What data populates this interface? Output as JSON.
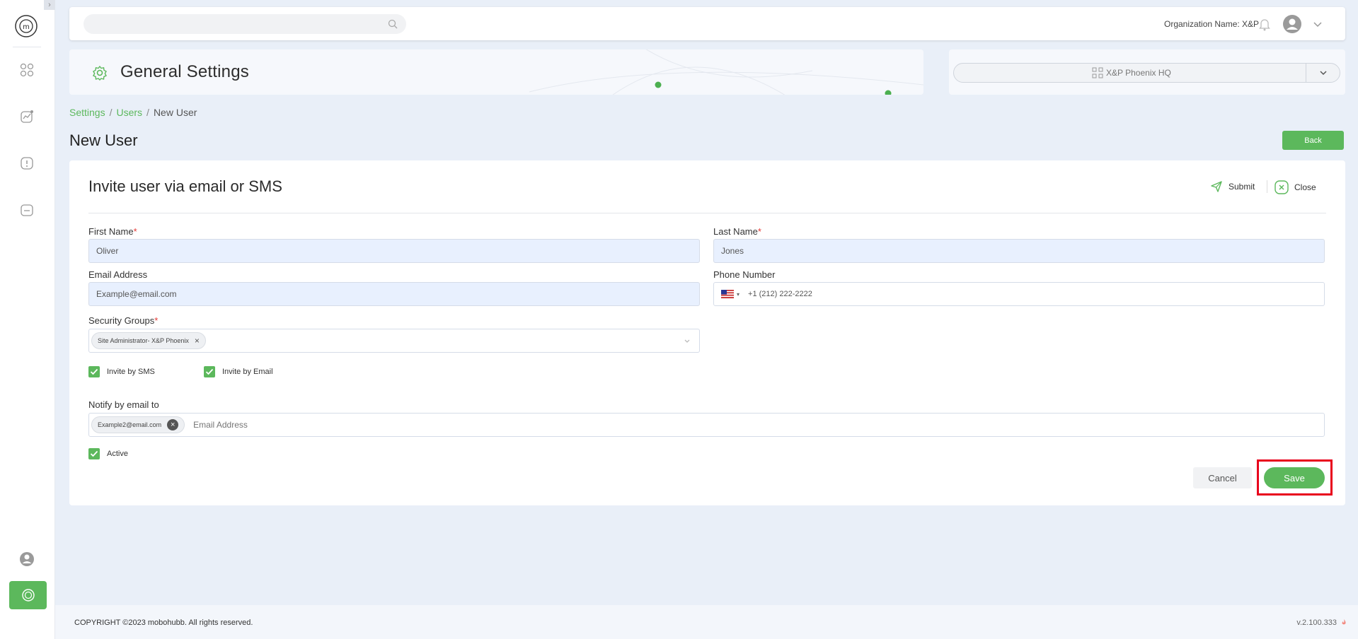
{
  "topbar": {
    "search_placeholder": "",
    "org_label": "Organization Name: X&P"
  },
  "banner": {
    "title": "General Settings"
  },
  "site_selector": {
    "selected": "X&P Phoenix HQ"
  },
  "breadcrumb": {
    "items": [
      "Settings",
      "Users",
      "New User"
    ],
    "separator": "/"
  },
  "page": {
    "title": "New User",
    "back_label": "Back"
  },
  "card": {
    "title": "Invite user via email or SMS",
    "submit_label": "Submit",
    "close_label": "Close"
  },
  "form": {
    "first_name": {
      "label": "First Name",
      "required": "*",
      "value": "Oliver"
    },
    "last_name": {
      "label": "Last Name",
      "required": "*",
      "value": "Jones"
    },
    "email": {
      "label": "Email Address",
      "value": "Example@email.com"
    },
    "phone": {
      "label": "Phone Number",
      "value": "+1 (212) 222-2222",
      "country_caret": "▾"
    },
    "security_groups": {
      "label": "Security Groups",
      "required": "*",
      "tags": [
        "Site Administrator- X&P Phoenix"
      ]
    },
    "invite_sms": {
      "label": "Invite by SMS",
      "checked": true
    },
    "invite_email": {
      "label": "Invite by Email",
      "checked": true
    },
    "notify": {
      "label": "Notify by email to",
      "tags": [
        "Example2@email.com"
      ],
      "placeholder": "Email Address"
    },
    "active": {
      "label": "Active",
      "checked": true
    }
  },
  "actions": {
    "cancel_label": "Cancel",
    "save_label": "Save"
  },
  "footer": {
    "copyright": "COPYRIGHT ©2023 mobohubb. All rights reserved.",
    "version": "v.2.100.333"
  },
  "colors": {
    "accent": "#5cb85c",
    "background": "#e9eff8",
    "highlight": "#e8001c",
    "required": "#e53935"
  }
}
